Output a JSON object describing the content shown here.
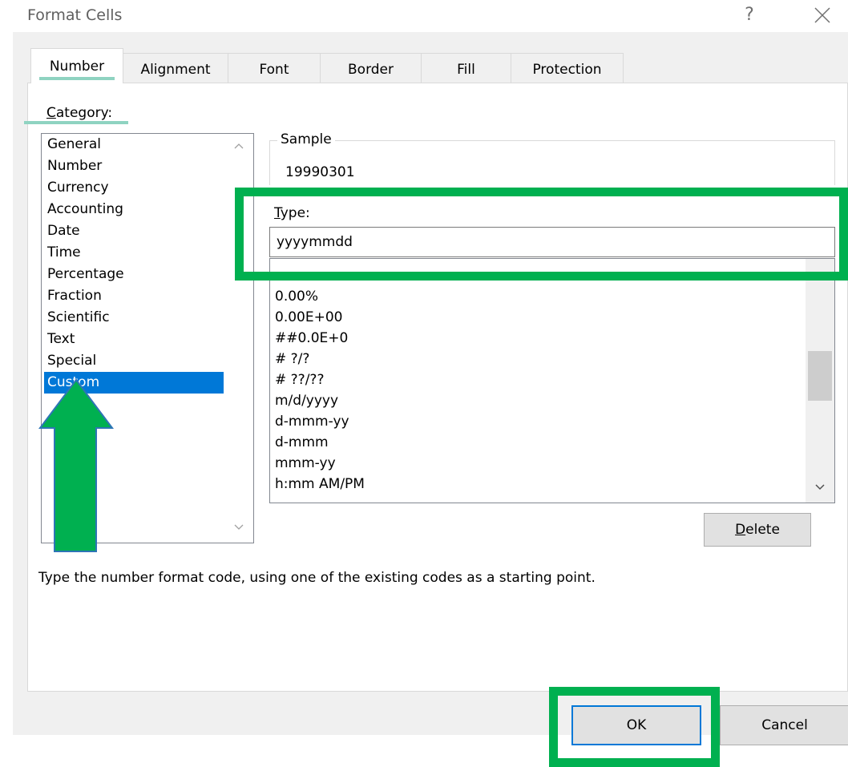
{
  "window": {
    "title": "Format Cells",
    "help_glyph": "?"
  },
  "tabs": [
    {
      "label": "Number",
      "active": true
    },
    {
      "label": "Alignment",
      "active": false
    },
    {
      "label": "Font",
      "active": false
    },
    {
      "label": "Border",
      "active": false
    },
    {
      "label": "Fill",
      "active": false
    },
    {
      "label": "Protection",
      "active": false
    }
  ],
  "category": {
    "label_first": "C",
    "label_rest": "ategory:",
    "items": [
      "General",
      "Number",
      "Currency",
      "Accounting",
      "Date",
      "Time",
      "Percentage",
      "Fraction",
      "Scientific",
      "Text",
      "Special",
      "Custom"
    ],
    "selected": "Custom"
  },
  "sample": {
    "label": "Sample",
    "value": "19990301"
  },
  "type": {
    "label_first": "T",
    "label_rest": "ype:",
    "value": "yyyymmdd"
  },
  "format_list": {
    "items": [
      "0.00%",
      "0.00E+00",
      "##0.0E+0",
      "# ?/?",
      "# ??/??",
      "m/d/yyyy",
      "d-mmm-yy",
      "d-mmm",
      "mmm-yy",
      "h:mm AM/PM"
    ]
  },
  "buttons": {
    "delete_first": "D",
    "delete_rest": "elete",
    "ok": "OK",
    "cancel": "Cancel"
  },
  "description": "Type the number format code, using one of the existing codes as a starting point.",
  "colors": {
    "highlight": "#00b050",
    "selection": "#0078d7",
    "tab_underline": "#8fd3c1",
    "arrow_outline": "#2e75b6"
  }
}
